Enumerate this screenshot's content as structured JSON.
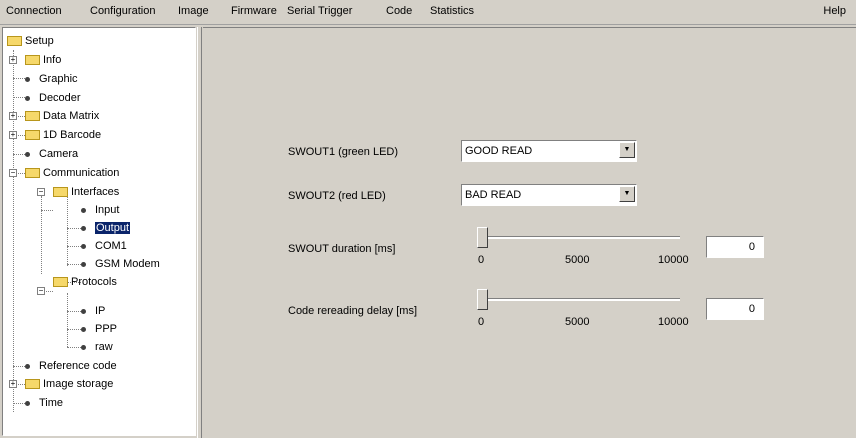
{
  "menu": {
    "items": [
      "Connection",
      "Configuration",
      "Image",
      "Firmware",
      "Serial Trigger",
      "Code",
      "Statistics"
    ],
    "help": "Help"
  },
  "tree": {
    "setup": "Setup",
    "info": "Info",
    "graphic": "Graphic",
    "decoder": "Decoder",
    "data_matrix": "Data Matrix",
    "barcode_1d": "1D Barcode",
    "camera": "Camera",
    "communication": "Communication",
    "interfaces": "Interfaces",
    "input": "Input",
    "output": "Output",
    "com1": "COM1",
    "gsm_modem": "GSM Modem",
    "protocols": "Protocols",
    "ip": "IP",
    "ppp": "PPP",
    "raw": "raw",
    "reference_code": "Reference code",
    "image_storage": "Image storage",
    "time": "Time"
  },
  "form": {
    "swout1_label": "SWOUT1 (green LED)",
    "swout1_value": "GOOD READ",
    "swout2_label": "SWOUT2 (red LED)",
    "swout2_value": "BAD READ",
    "duration_label": "SWOUT duration [ms]",
    "duration_value": "0",
    "duration_ticks": [
      "0",
      "5000",
      "10000"
    ],
    "duration_level": 0,
    "delay_label": "Code rereading delay [ms]",
    "delay_value": "0",
    "delay_ticks": [
      "0",
      "5000",
      "10000"
    ],
    "delay_level": 0
  }
}
